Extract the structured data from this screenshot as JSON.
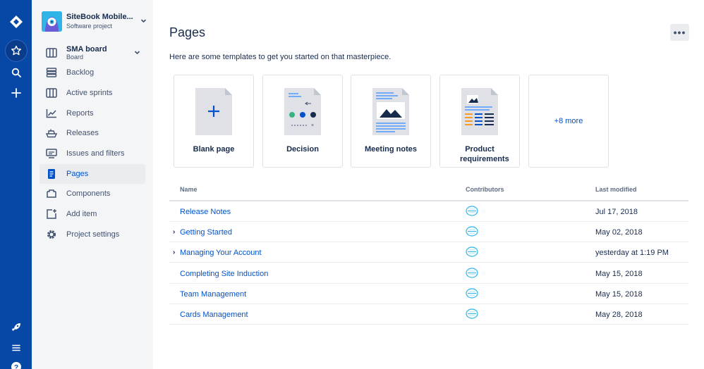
{
  "project": {
    "name": "SiteBook Mobile...",
    "type": "Software project"
  },
  "board": {
    "name": "SMA board",
    "type": "Board"
  },
  "sidebar": {
    "items": [
      {
        "label": "Backlog",
        "icon": "backlog-icon"
      },
      {
        "label": "Active sprints",
        "icon": "columns-icon"
      },
      {
        "label": "Reports",
        "icon": "chart-icon"
      },
      {
        "label": "Releases",
        "icon": "ship-icon"
      },
      {
        "label": "Issues and filters",
        "icon": "monitor-icon"
      },
      {
        "label": "Pages",
        "icon": "page-icon",
        "active": true
      },
      {
        "label": "Components",
        "icon": "component-icon"
      },
      {
        "label": "Add item",
        "icon": "add-item-icon"
      },
      {
        "label": "Project settings",
        "icon": "gear-icon"
      }
    ]
  },
  "page": {
    "title": "Pages",
    "intro": "Here are some templates to get you started on that masterpiece."
  },
  "templates": [
    {
      "label": "Blank page"
    },
    {
      "label": "Decision"
    },
    {
      "label": "Meeting notes"
    },
    {
      "label": "Product requirements"
    }
  ],
  "more_templates": "+8 more",
  "table": {
    "headers": {
      "name": "Name",
      "contributors": "Contributors",
      "modified": "Last modified"
    },
    "rows": [
      {
        "name": "Release Notes",
        "modified": "Jul 17, 2018",
        "expandable": false
      },
      {
        "name": "Getting Started",
        "modified": "May 02, 2018",
        "expandable": true
      },
      {
        "name": "Managing Your Account",
        "modified": "yesterday at 1:19 PM",
        "expandable": true
      },
      {
        "name": "Completing Site Induction",
        "modified": "May 15, 2018",
        "expandable": false
      },
      {
        "name": "Team Management",
        "modified": "May 15, 2018",
        "expandable": false
      },
      {
        "name": "Cards Management",
        "modified": "May 28, 2018",
        "expandable": false
      }
    ]
  },
  "colors": {
    "global_nav": "#0747A6",
    "link": "#0052CC",
    "sidebar_bg": "#F4F5F7"
  }
}
